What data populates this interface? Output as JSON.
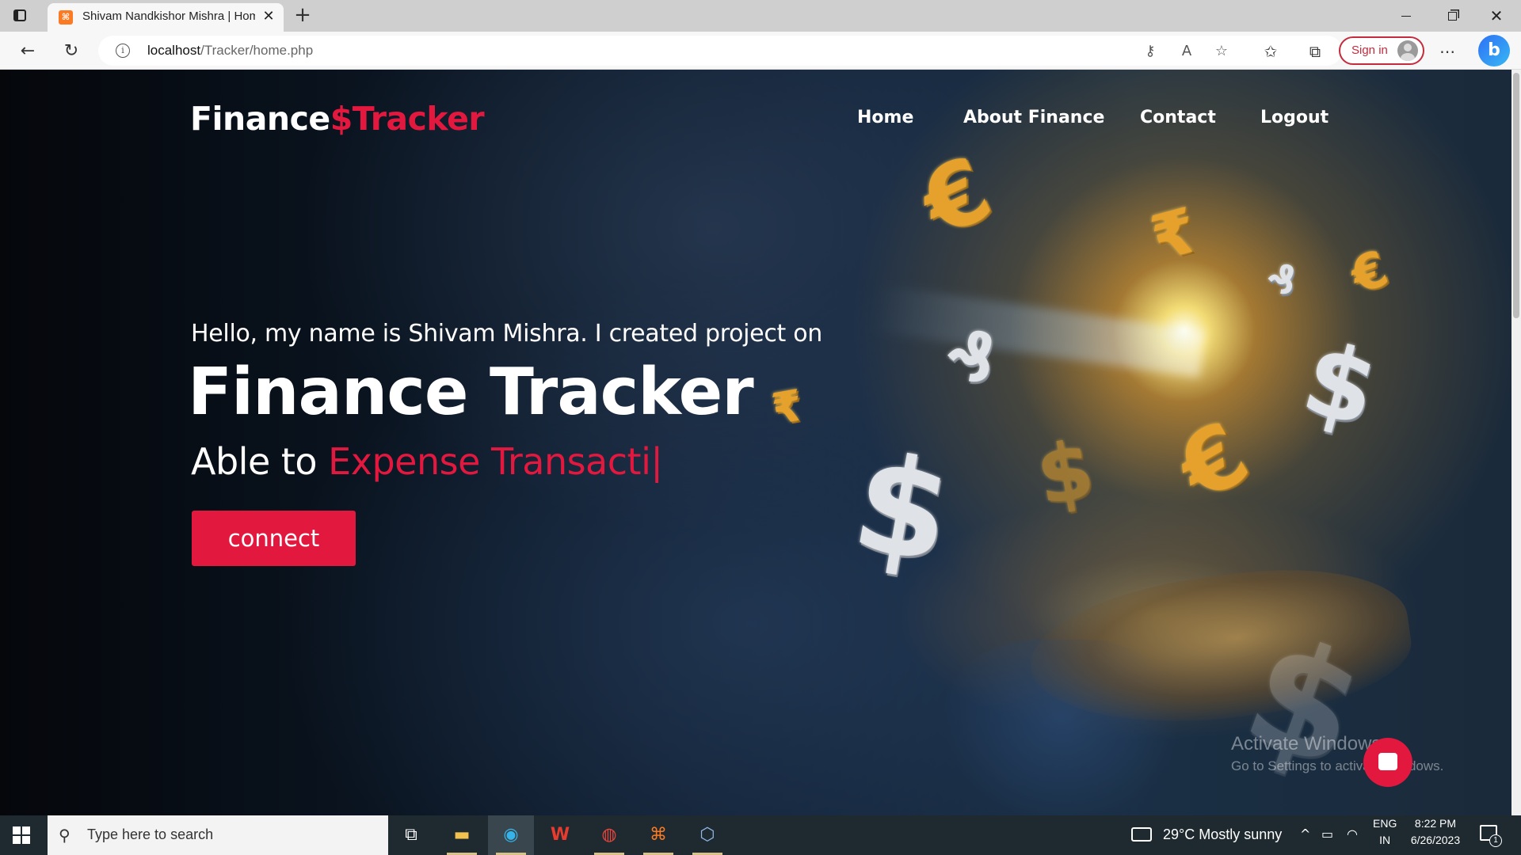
{
  "browser": {
    "tab_title": "Shivam Nandkishor Mishra | Hom",
    "tab_favicon": "xampp-icon",
    "url_host": "localhost",
    "url_path": "/Tracker/home.php",
    "sign_in_label": "Sign in",
    "accent_color": "#c42b3c"
  },
  "site": {
    "logo_part1": "Finance",
    "logo_part2": "$Tracker",
    "nav": {
      "home": "Home",
      "about": "About Finance",
      "contact": "Contact",
      "logout": "Logout"
    },
    "hero": {
      "intro": "Hello, my name is Shivam Mishra. I created project on",
      "title": "Finance Tracker",
      "able_prefix": "Able to ",
      "typed_text": "Expense Transacti",
      "caret": "|",
      "button_label": "connect"
    },
    "accent_color": "#e3183f"
  },
  "overlay": {
    "activate_line1": "Activate Windows",
    "activate_line2": "Go to Settings to activate Windows."
  },
  "taskbar": {
    "search_placeholder": "Type here to search",
    "weather": "29°C  Mostly sunny",
    "lang_line1": "ENG",
    "lang_line2": "IN",
    "time": "8:22 PM",
    "date": "6/26/2023",
    "notification_count": "1",
    "apps": [
      "task-view-icon",
      "file-explorer-icon",
      "edge-icon",
      "wps-office-icon",
      "chrome-icon",
      "xampp-icon",
      "virtualbox-icon"
    ]
  }
}
